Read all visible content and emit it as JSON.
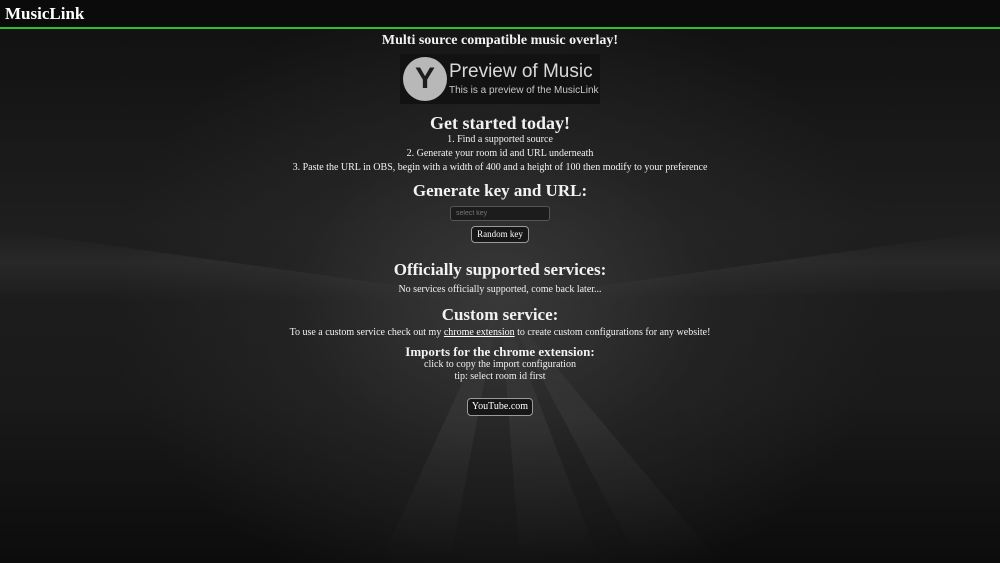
{
  "app": {
    "name": "MusicLink",
    "accent_color": "#2fc02f"
  },
  "main": {
    "tagline": "Multi source compatible music overlay!",
    "preview": {
      "logo_letter": "Y",
      "title": "Preview of Music",
      "subtitle": "This is a preview of the MusicLink"
    },
    "get_started": {
      "heading": "Get started today!",
      "steps": [
        "1. Find a supported source",
        "2. Generate your room id and URL underneath",
        "3. Paste the URL in OBS, begin with a width of 400 and a height of 100 then modify to your preference"
      ]
    },
    "generate": {
      "heading": "Generate key and URL:",
      "key_placeholder": "select key",
      "random_key_label": "Random key"
    },
    "official": {
      "heading": "Officially supported services:",
      "empty_text": "No services officially supported, come back later..."
    },
    "custom": {
      "heading": "Custom service:",
      "text_before": "To use a custom service check out my ",
      "link_text": "chrome extension",
      "text_after": " to create custom configurations for any website!"
    },
    "imports": {
      "heading": "Imports for the chrome extension:",
      "copy_hint": "click to copy the import configuration",
      "tip": "tip: select room id first",
      "services": [
        "YouTube.com"
      ]
    }
  }
}
